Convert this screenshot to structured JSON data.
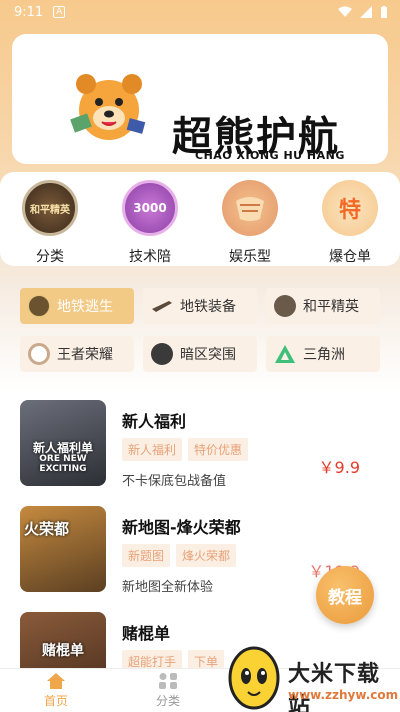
{
  "status": {
    "time": "9:11",
    "app_badge": "A"
  },
  "brand": {
    "title": "超熊护航",
    "subtitle": "CHAO XIONG HU HANG"
  },
  "categories": [
    {
      "label": "分类",
      "icon": "peace-elite-logo-icon",
      "badge": "和平精英"
    },
    {
      "label": "技术陪",
      "icon": "purple-badge-3000-icon",
      "badge": "3000"
    },
    {
      "label": "娱乐型",
      "icon": "orange-food-icon",
      "badge": ""
    },
    {
      "label": "爆仓单",
      "icon": "orange-te-icon",
      "badge": "特"
    }
  ],
  "chips": [
    {
      "label": "地铁逃生",
      "active": true
    },
    {
      "label": "地铁装备",
      "active": false
    },
    {
      "label": "和平精英",
      "active": false
    },
    {
      "label": "王者荣耀",
      "active": false
    },
    {
      "label": "暗区突围",
      "active": false
    },
    {
      "label": "三角洲",
      "active": false
    }
  ],
  "products": [
    {
      "title": "新人福利",
      "tags": [
        "新人福利",
        "特价优惠"
      ],
      "desc": "不卡保底包战备值",
      "price": "￥9.9",
      "thumb_text": "新人福利单",
      "thumb_sub": "ORE NEW EXCITING"
    },
    {
      "title": "新地图-烽火荣都",
      "tags": [
        "新题图",
        "烽火荣都"
      ],
      "desc": "新地图全新体验",
      "price": "￥19.9",
      "thumb_text": "火荣都",
      "thumb_sub": ""
    },
    {
      "title": "赌棍单",
      "tags": [
        "超能打手",
        "下单"
      ],
      "desc": "",
      "price": "",
      "thumb_text": "赌棍单",
      "thumb_sub": ""
    }
  ],
  "fab": {
    "label": "教程"
  },
  "tabs": [
    {
      "label": "首页",
      "active": true
    },
    {
      "label": "分类",
      "active": false
    }
  ],
  "watermark": {
    "name": "大米下载站",
    "url": "www.zzhyw.com"
  },
  "colors": {
    "accent": "#f0a64a",
    "price": "#e53b2c",
    "tag_bg": "#fbeee2",
    "tag_text": "#e7a37a"
  }
}
